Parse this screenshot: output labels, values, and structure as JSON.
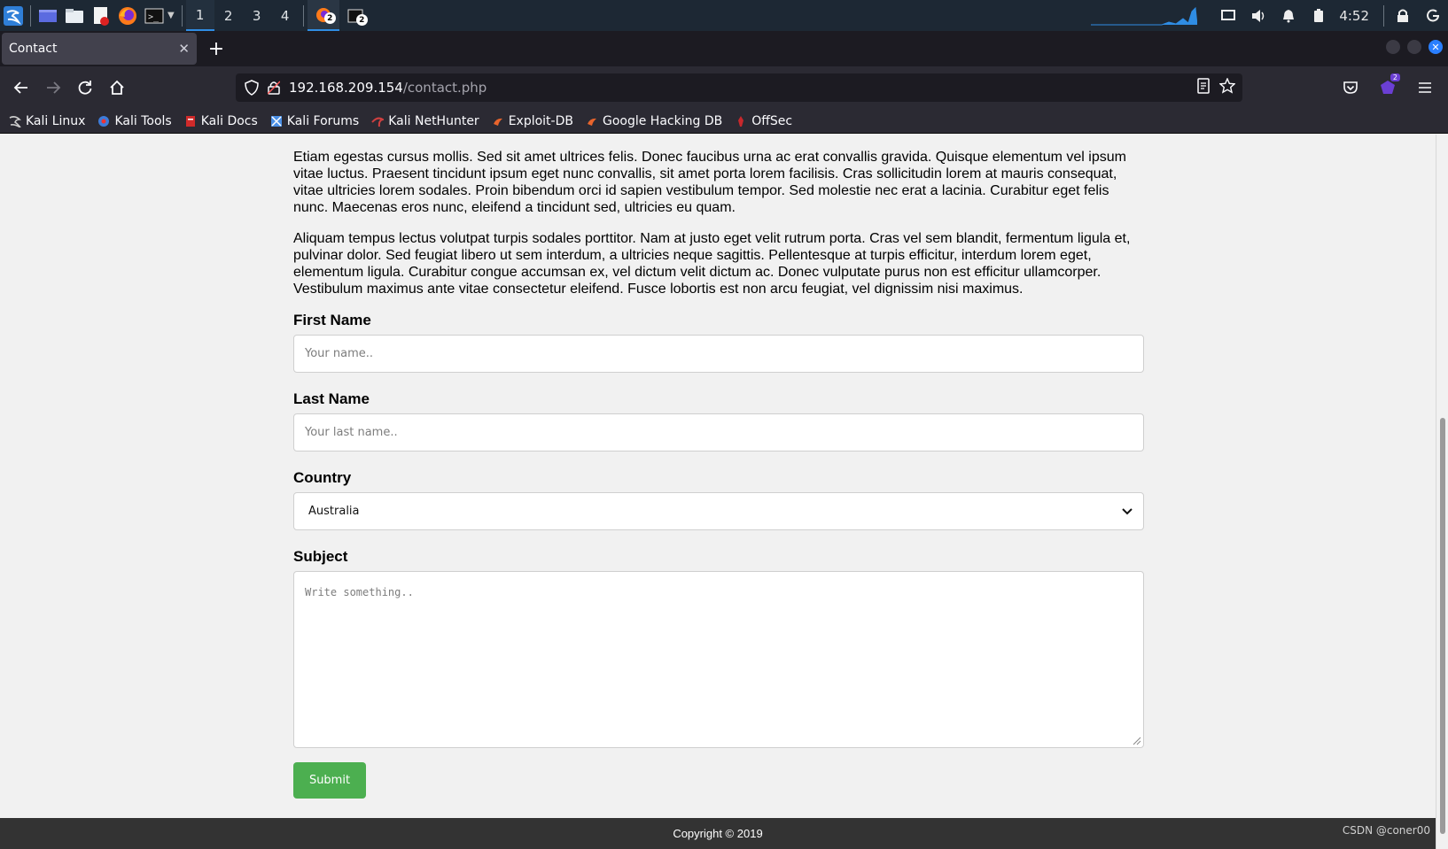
{
  "panel": {
    "workspaces": [
      "1",
      "2",
      "3",
      "4"
    ],
    "active_workspace": "1",
    "window_badges": [
      "2",
      "2"
    ],
    "clock": "4:52"
  },
  "browser": {
    "tab_title": "Contact",
    "url_host": "192.168.209.154",
    "url_path": "/contact.php",
    "extension_badge": "2"
  },
  "bookmarks": [
    {
      "label": "Kali Linux",
      "icon": "kali-dragon-icon",
      "color": "#cccccc"
    },
    {
      "label": "Kali Tools",
      "icon": "kali-tools-icon",
      "color": "#3d7bd9"
    },
    {
      "label": "Kali Docs",
      "icon": "kali-docs-icon",
      "color": "#d02a2a"
    },
    {
      "label": "Kali Forums",
      "icon": "kali-forums-icon",
      "color": "#4a8fe6"
    },
    {
      "label": "Kali NetHunter",
      "icon": "nethunter-icon",
      "color": "#d04040"
    },
    {
      "label": "Exploit-DB",
      "icon": "exploit-db-icon",
      "color": "#e8642c"
    },
    {
      "label": "Google Hacking DB",
      "icon": "ghdb-icon",
      "color": "#e8642c"
    },
    {
      "label": "OffSec",
      "icon": "offsec-icon",
      "color": "#c8282c"
    }
  ],
  "page": {
    "paragraph1": "Etiam egestas cursus mollis. Sed sit amet ultrices felis. Donec faucibus urna ac erat convallis gravida. Quisque elementum vel ipsum vitae luctus. Praesent tincidunt ipsum eget nunc convallis, sit amet porta lorem facilisis. Cras sollicitudin lorem at mauris consequat, vitae ultricies lorem sodales. Proin bibendum orci id sapien vestibulum tempor. Sed molestie nec erat a lacinia. Curabitur eget felis nunc. Maecenas eros nunc, eleifend a tincidunt sed, ultricies eu quam.",
    "paragraph2": "Aliquam tempus lectus volutpat turpis sodales porttitor. Nam at justo eget velit rutrum porta. Cras vel sem blandit, fermentum ligula et, pulvinar dolor. Sed feugiat libero ut sem interdum, a ultricies neque sagittis. Pellentesque at turpis efficitur, interdum lorem eget, elementum ligula. Curabitur congue accumsan ex, vel dictum velit dictum ac. Donec vulputate purus non est efficitur ullamcorper. Vestibulum maximus ante vitae consectetur eleifend. Fusce lobortis est non arcu feugiat, vel dignissim nisi maximus.",
    "form": {
      "first_name_label": "First Name",
      "first_name_placeholder": "Your name..",
      "last_name_label": "Last Name",
      "last_name_placeholder": "Your last name..",
      "country_label": "Country",
      "country_selected": "Australia",
      "subject_label": "Subject",
      "subject_placeholder": "Write something..",
      "submit_label": "Submit",
      "submit_color": "#4caf50"
    },
    "footer": "Copyright © 2019"
  },
  "watermark": "CSDN @coner00"
}
